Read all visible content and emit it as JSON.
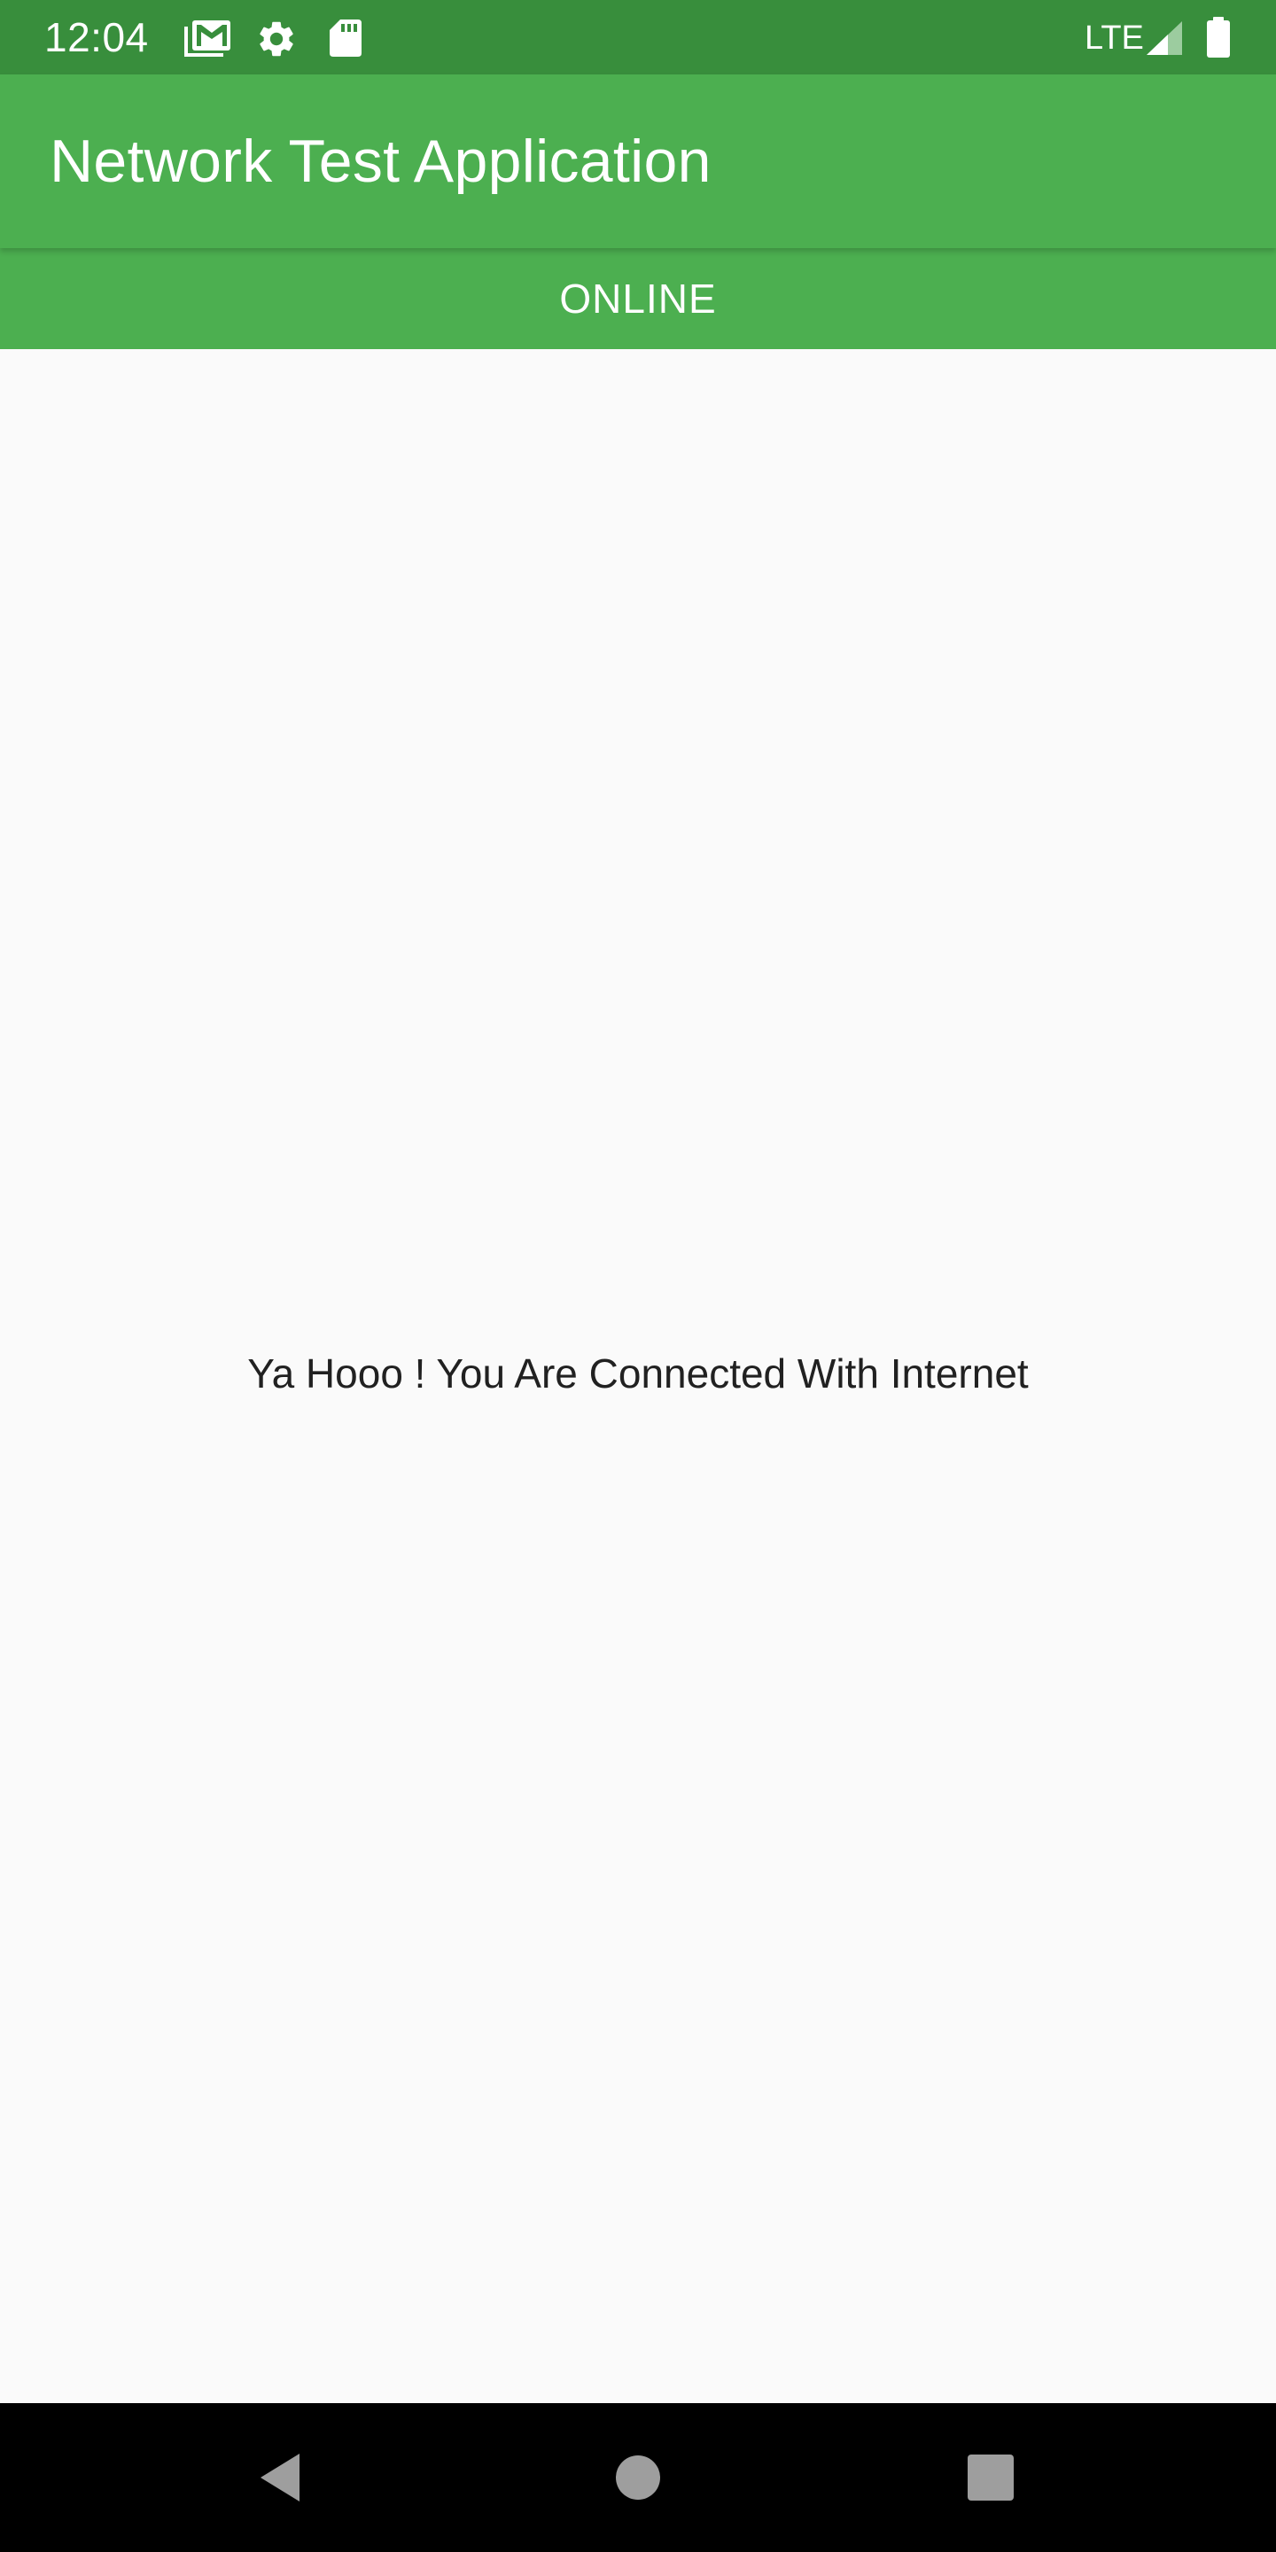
{
  "status_bar": {
    "time": "12:04",
    "network": "LTE",
    "icons": [
      "gmail-icon",
      "settings-gear-icon",
      "sd-card-icon",
      "signal-icon",
      "battery-icon"
    ],
    "background_color": "#388e3c"
  },
  "app_bar": {
    "title": "Network Test Application",
    "background_color": "#4caf50"
  },
  "connection_banner": {
    "status": "ONLINE",
    "background_color": "#4caf50"
  },
  "content": {
    "message": "Ya Hooo ! You Are Connected With Internet"
  },
  "navigation_bar": {
    "buttons": [
      "back-icon",
      "home-icon",
      "recents-icon"
    ]
  }
}
